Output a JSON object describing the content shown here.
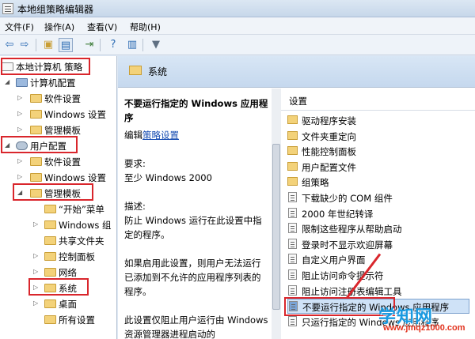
{
  "window": {
    "title": "本地组策略编辑器"
  },
  "menu": [
    "文件(F)",
    "操作(A)",
    "查看(V)",
    "帮助(H)"
  ],
  "tree": [
    {
      "label": "本地计算机 策略",
      "highlighted": true
    },
    {
      "label": "计算机配置"
    },
    {
      "label": "软件设置"
    },
    {
      "label": "Windows 设置"
    },
    {
      "label": "管理模板"
    },
    {
      "label": "用户配置",
      "highlighted": true
    },
    {
      "label": "软件设置"
    },
    {
      "label": "Windows 设置"
    },
    {
      "label": "管理模板",
      "highlighted": true
    },
    {
      "label": "“开始”菜单"
    },
    {
      "label": "Windows 组"
    },
    {
      "label": "共享文件夹"
    },
    {
      "label": "控制面板"
    },
    {
      "label": "网络"
    },
    {
      "label": "系统",
      "highlighted": true
    },
    {
      "label": "桌面"
    },
    {
      "label": "所有设置"
    }
  ],
  "detail": {
    "header_title": "系统",
    "policy_title": "不要运行指定的 Windows 应用程序",
    "edit_prefix": "编辑",
    "edit_link": "策略设置",
    "requirements_label": "要求:",
    "requirements_value": "至少 Windows 2000",
    "description_label": "描述:",
    "description_1": "防止 Windows 运行在此设置中指定的程序。",
    "description_2": "如果启用此设置，则用户无法运行已添加到不允许的应用程序列表的程序。",
    "description_3": "此设置仅阻止用户运行由 Windows 资源管理器进程启动的"
  },
  "settings": {
    "header": "设置",
    "items": [
      {
        "label": "驱动程序安装",
        "kind": "folder"
      },
      {
        "label": "文件夹重定向",
        "kind": "folder"
      },
      {
        "label": "性能控制面板",
        "kind": "folder"
      },
      {
        "label": "用户配置文件",
        "kind": "folder"
      },
      {
        "label": "组策略",
        "kind": "folder"
      },
      {
        "label": "下载缺少的 COM 组件",
        "kind": "policy"
      },
      {
        "label": "2000 年世纪转译",
        "kind": "policy"
      },
      {
        "label": "限制这些程序从帮助启动",
        "kind": "policy"
      },
      {
        "label": "登录时不显示欢迎屏幕",
        "kind": "policy"
      },
      {
        "label": "自定义用户界面",
        "kind": "policy"
      },
      {
        "label": "阻止访问命令提示符",
        "kind": "policy"
      },
      {
        "label": "阻止访问注册表编辑工具",
        "kind": "policy"
      },
      {
        "label": "不要运行指定的 Windows 应用程序",
        "kind": "policy",
        "selected": true
      },
      {
        "label": "只运行指定的 Windows 应用程序",
        "kind": "policy"
      }
    ]
  },
  "watermark": {
    "logo": "学知网",
    "url": "www.jmqz1000.com"
  },
  "colors": {
    "highlight_box": "#d9262c",
    "selection": "#cfe2f7",
    "folder": "#f3d27a"
  }
}
